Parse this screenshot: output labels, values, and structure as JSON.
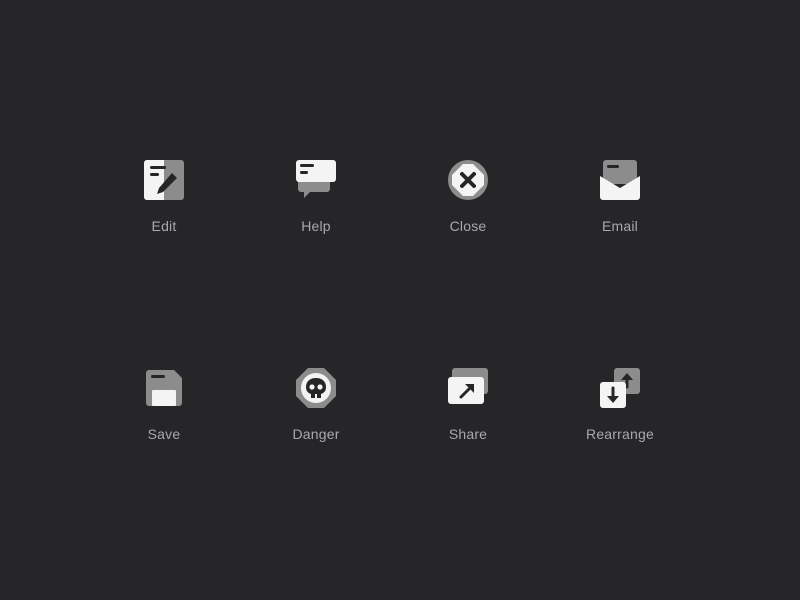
{
  "colors": {
    "background": "#262628",
    "icon_light": "#f4f4f4",
    "icon_mid": "#8c8c8c",
    "icon_dark": "#262628",
    "label": "#a9a9ab"
  },
  "icons": [
    {
      "key": "edit",
      "label": "Edit",
      "icon": "edit-icon"
    },
    {
      "key": "help",
      "label": "Help",
      "icon": "help-icon"
    },
    {
      "key": "close",
      "label": "Close",
      "icon": "close-icon"
    },
    {
      "key": "email",
      "label": "Email",
      "icon": "email-icon"
    },
    {
      "key": "save",
      "label": "Save",
      "icon": "save-icon"
    },
    {
      "key": "danger",
      "label": "Danger",
      "icon": "danger-icon"
    },
    {
      "key": "share",
      "label": "Share",
      "icon": "share-icon"
    },
    {
      "key": "rearrange",
      "label": "Rearrange",
      "icon": "rearrange-icon"
    }
  ]
}
